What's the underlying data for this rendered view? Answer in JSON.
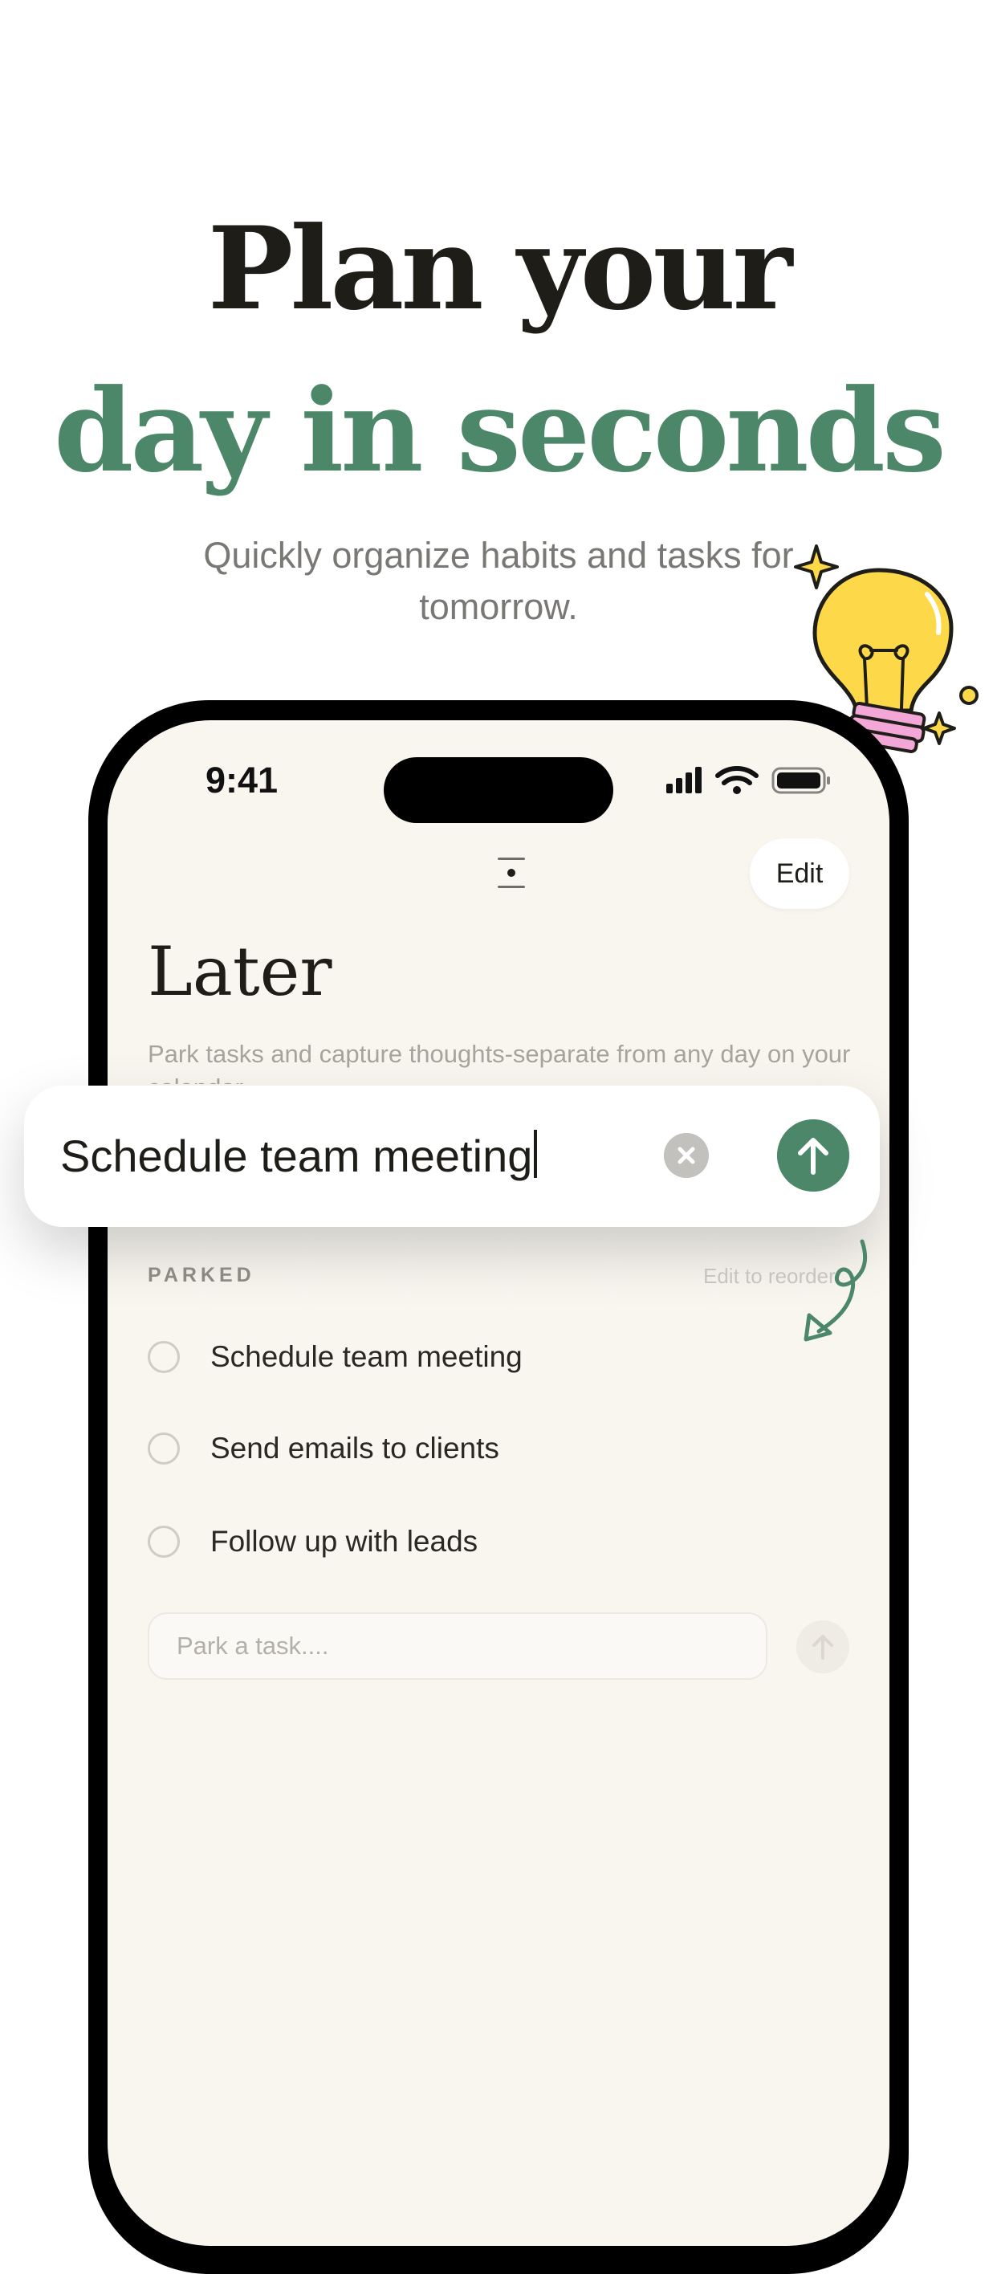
{
  "hero": {
    "line1": "Plan your",
    "line2": "day in seconds",
    "subtitle": "Quickly organize habits and tasks for tomorrow."
  },
  "status_bar": {
    "time": "9:41",
    "icons": [
      "cellular-signal-icon",
      "wifi-icon",
      "battery-icon"
    ]
  },
  "sheet": {
    "edit_label": "Edit",
    "title": "Later",
    "description": "Park tasks and capture thoughts-separate from any day on your calendar."
  },
  "task_input": {
    "value": "Schedule team meeting",
    "clear_icon": "clear-icon",
    "send_icon": "arrow-up-icon"
  },
  "parked": {
    "section_label": "PARKED",
    "reorder_hint": "Edit to reorder",
    "tasks": [
      {
        "label": "Schedule team meeting",
        "done": false
      },
      {
        "label": "Send emails to clients",
        "done": false
      },
      {
        "label": "Follow up with leads",
        "done": false
      }
    ],
    "placeholder": "Park a task...."
  },
  "colors": {
    "accent_green": "#4d8769",
    "headline_dark": "#1f1d18",
    "bulb_yellow": "#fdd94a",
    "bulb_pink": "#f2a7d7",
    "screen_bg": "#f9f6f0"
  }
}
